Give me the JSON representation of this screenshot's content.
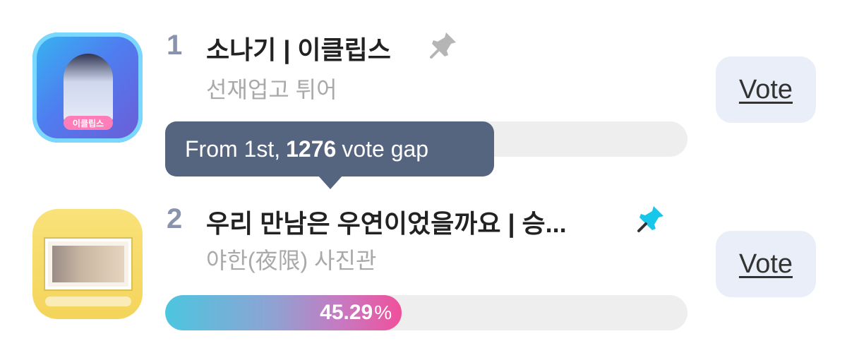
{
  "items": [
    {
      "rank": "1",
      "title": "소나기 | 이클립스",
      "subtitle": "선재업고 튀어",
      "thumbnail_tag": "이클립스",
      "pinned": false,
      "pin_color": "#b5b5b5",
      "vote_label": "Vote"
    },
    {
      "rank": "2",
      "title": "우리 만남은 우연이었을까요 | 승...",
      "subtitle": "야한(夜限) 사진관",
      "pinned": true,
      "pin_color": "#16c7e9",
      "vote_label": "Vote",
      "progress_percent": 45.29,
      "progress_number": "45.29",
      "progress_suffix": "%"
    }
  ],
  "tooltip": {
    "prefix": "From 1st,",
    "gap_value": "1276",
    "suffix": "vote gap"
  },
  "colors": {
    "accent_gradient_start": "#4cc6df",
    "accent_gradient_end": "#f0509b",
    "tooltip_bg": "#56657f",
    "vote_button_bg": "#e9eef8"
  }
}
